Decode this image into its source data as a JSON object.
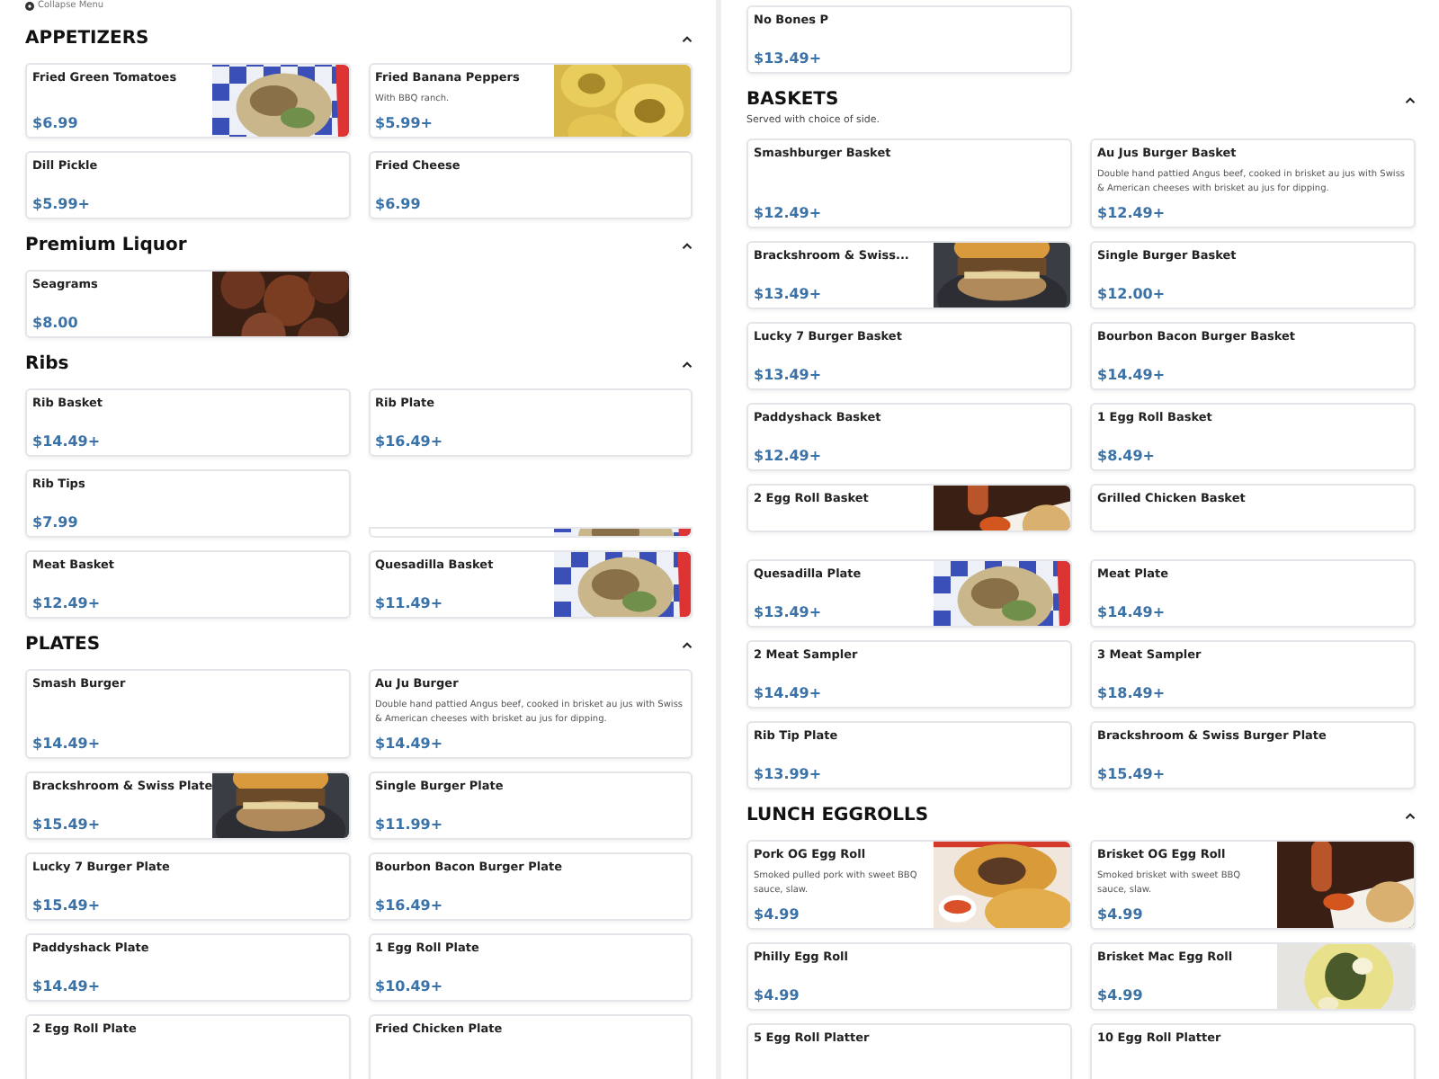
{
  "collapse_menu": {
    "label": "Collapse Menu"
  },
  "panels": [
    {
      "sections": [
        {
          "title": "APPETIZERS",
          "expanded": true,
          "items": [
            {
              "kind": "card",
              "name": "Fried Green Tomatoes",
              "price": "$6.99"
            },
            {
              "kind": "card",
              "name": "Fried Banana Peppers",
              "description": "With BBQ ranch.",
              "price": "$5.99+"
            },
            {
              "kind": "card",
              "name": "Dill Pickle",
              "price": "$5.99+"
            },
            {
              "kind": "card",
              "name": "Fried Cheese",
              "price": "$6.99"
            }
          ]
        },
        {
          "title": "Premium Liquor",
          "expanded": true,
          "items": [
            {
              "kind": "card",
              "name": "Seagrams",
              "price": "$8.00"
            }
          ]
        },
        {
          "title": "Ribs",
          "expanded": true,
          "items": [
            {
              "kind": "card",
              "name": "Rib Basket",
              "price": "$14.49+"
            },
            {
              "kind": "card",
              "name": "Rib Plate",
              "price": "$16.49+"
            },
            {
              "kind": "card",
              "name": "Rib Tips",
              "price": "$7.99"
            },
            {
              "kind": "fragment"
            },
            {
              "kind": "card",
              "name": "Meat Basket",
              "price": "$12.49+"
            },
            {
              "kind": "card",
              "name": "Quesadilla Basket",
              "price": "$11.49+"
            }
          ]
        },
        {
          "title": "PLATES",
          "expanded": true,
          "items": [
            {
              "kind": "card",
              "name": "Smash Burger",
              "price": "$14.49+"
            },
            {
              "kind": "card",
              "name": "Au Ju Burger",
              "description": "Double hand pattied Angus beef, cooked in brisket au jus with Swiss & American cheeses with brisket au jus for dipping.",
              "price": "$14.49+"
            },
            {
              "kind": "card",
              "name": "Brackshroom & Swiss Plate",
              "price": "$15.49+"
            },
            {
              "kind": "card",
              "name": "Single Burger Plate",
              "price": "$11.99+"
            },
            {
              "kind": "card",
              "name": "Lucky 7 Burger Plate",
              "price": "$15.49+"
            },
            {
              "kind": "card",
              "name": "Bourbon Bacon Burger Plate",
              "price": "$16.49+"
            },
            {
              "kind": "card",
              "name": "Paddyshack Plate",
              "price": "$14.49+"
            },
            {
              "kind": "card",
              "name": "1 Egg Roll Plate",
              "price": "$10.49+"
            },
            {
              "kind": "card",
              "name": "2 Egg Roll Plate"
            },
            {
              "kind": "card",
              "name": "Fried Chicken Plate"
            }
          ]
        }
      ]
    },
    {
      "sections": [
        {
          "items": [
            {
              "kind": "card",
              "name": "No Bones P",
              "price": "$13.49+"
            }
          ]
        },
        {
          "title": "BASKETS",
          "subtitle": "Served with choice of side.",
          "expanded": true,
          "items": [
            {
              "kind": "card",
              "name": "Smashburger Basket",
              "price": "$12.49+"
            },
            {
              "kind": "card",
              "name": "Au Jus Burger Basket",
              "description": "Double hand pattied Angus beef, cooked in brisket au jus with Swiss & American cheeses with brisket au jus for dipping.",
              "price": "$12.49+"
            },
            {
              "kind": "card",
              "name": "Brackshroom & Swiss...",
              "price": "$13.49+"
            },
            {
              "kind": "card",
              "name": "Single Burger Basket",
              "price": "$12.00+"
            },
            {
              "kind": "card",
              "name": "Lucky 7 Burger Basket",
              "price": "$13.49+"
            },
            {
              "kind": "card",
              "name": "Bourbon Bacon Burger Basket",
              "price": "$14.49+"
            },
            {
              "kind": "card",
              "name": "Paddyshack Basket",
              "price": "$12.49+"
            },
            {
              "kind": "card",
              "name": "1 Egg Roll Basket",
              "price": "$8.49+"
            },
            {
              "kind": "clipped",
              "name": "2 Egg Roll Basket"
            },
            {
              "kind": "clipped",
              "name": "Grilled Chicken Basket"
            },
            {
              "kind": "card",
              "name": "Quesadilla Plate",
              "price": "$13.49+"
            },
            {
              "kind": "card",
              "name": "Meat Plate",
              "price": "$14.49+"
            },
            {
              "kind": "card",
              "name": "2 Meat Sampler",
              "price": "$14.49+"
            },
            {
              "kind": "card",
              "name": "3 Meat Sampler",
              "price": "$18.49+"
            },
            {
              "kind": "card",
              "name": "Rib Tip Plate",
              "price": "$13.99+"
            },
            {
              "kind": "card",
              "name": "Brackshroom & Swiss Burger Plate",
              "price": "$15.49+"
            }
          ]
        },
        {
          "title": "LUNCH EGGROLLS",
          "expanded": true,
          "items": [
            {
              "kind": "card",
              "name": "Pork OG Egg Roll",
              "description": "Smoked pulled pork with sweet BBQ sauce, slaw.",
              "price": "$4.99"
            },
            {
              "kind": "card",
              "name": "Brisket OG Egg Roll",
              "description": "Smoked brisket with sweet BBQ sauce, slaw.",
              "price": "$4.99"
            },
            {
              "kind": "card",
              "name": "Philly Egg Roll",
              "price": "$4.99"
            },
            {
              "kind": "card",
              "name": "Brisket Mac Egg Roll",
              "price": "$4.99"
            },
            {
              "kind": "card",
              "name": "5 Egg Roll Platter"
            },
            {
              "kind": "card",
              "name": "10 Egg Roll Platter"
            }
          ]
        }
      ]
    }
  ]
}
